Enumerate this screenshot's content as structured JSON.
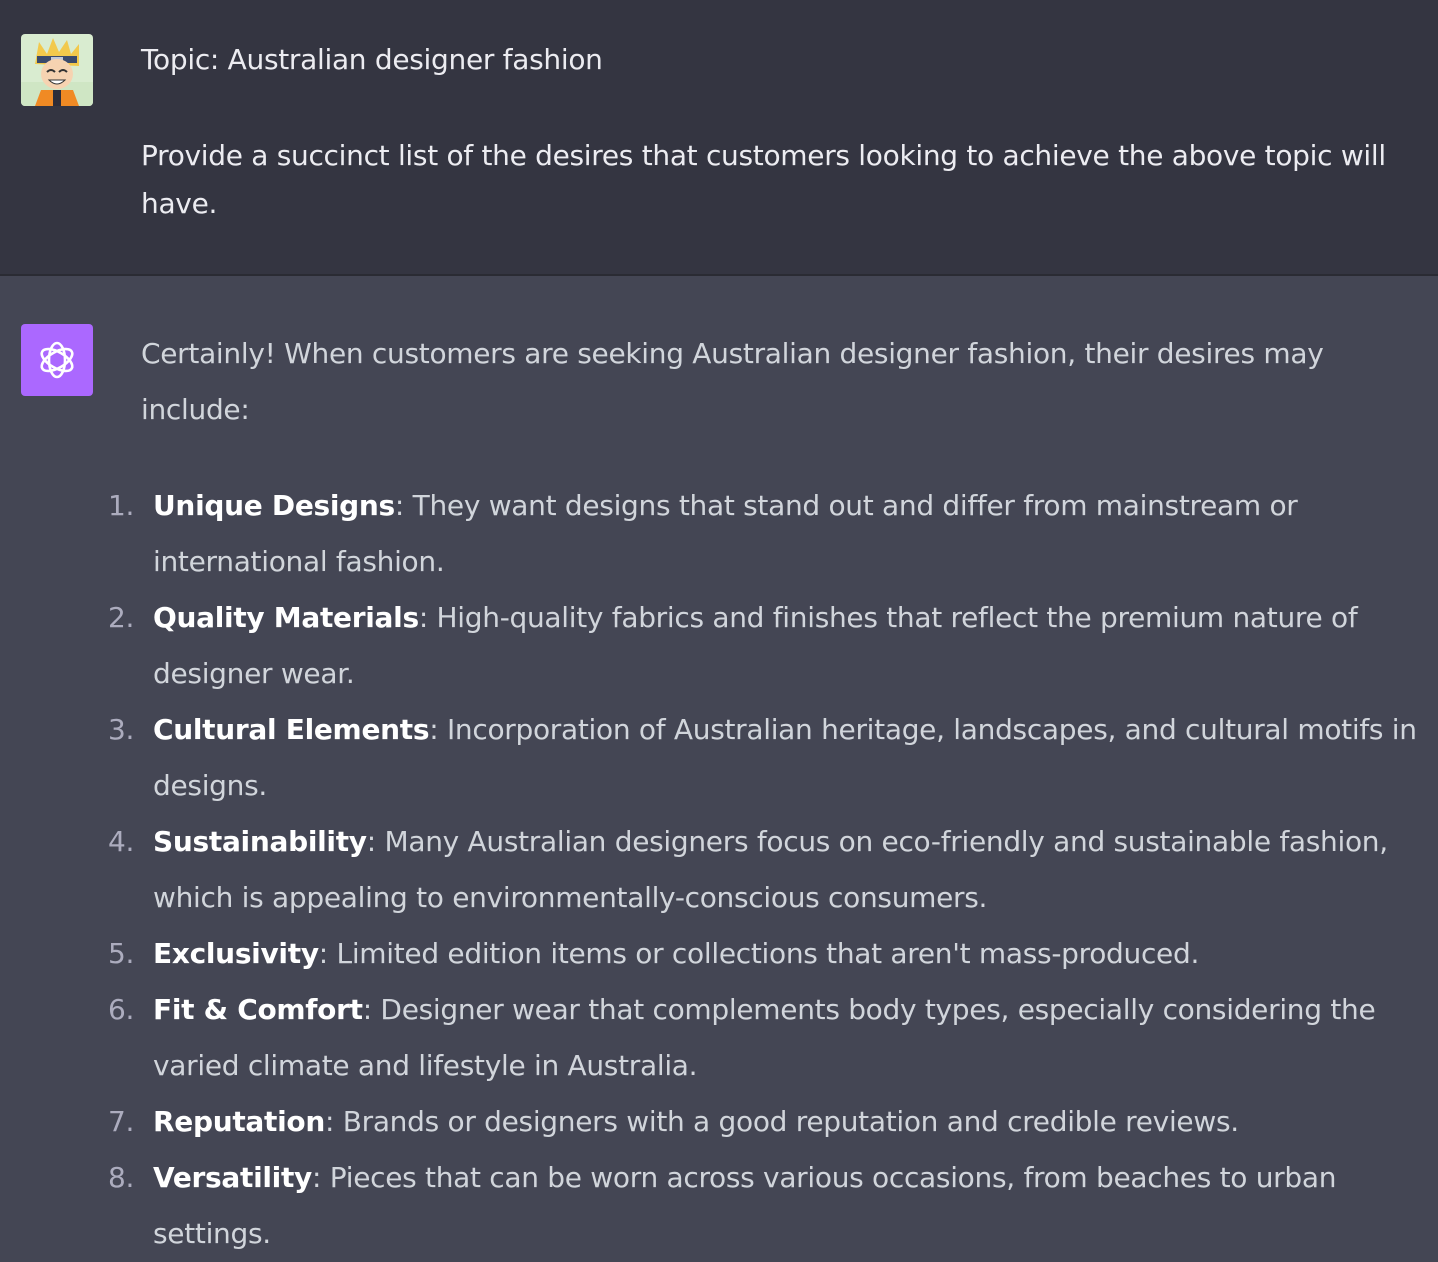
{
  "user_message": {
    "line1": "Topic: Australian designer fashion",
    "line2": "Provide a succinct list of the desires that customers looking to achieve the above topic will have."
  },
  "assistant_message": {
    "intro": "Certainly! When customers are seeking Australian designer fashion, their desires may include:",
    "items": [
      {
        "num": "1.",
        "term": "Unique Designs",
        "desc": ": They want designs that stand out and differ from mainstream or international fashion."
      },
      {
        "num": "2.",
        "term": "Quality Materials",
        "desc": ": High-quality fabrics and finishes that reflect the premium nature of designer wear."
      },
      {
        "num": "3.",
        "term": "Cultural Elements",
        "desc": ": Incorporation of Australian heritage, landscapes, and cultural motifs in designs."
      },
      {
        "num": "4.",
        "term": "Sustainability",
        "desc": ": Many Australian designers focus on eco-friendly and sustainable fashion, which is appealing to environmentally-conscious consumers."
      },
      {
        "num": "5.",
        "term": "Exclusivity",
        "desc": ": Limited edition items or collections that aren't mass-produced."
      },
      {
        "num": "6.",
        "term": "Fit & Comfort",
        "desc": ": Designer wear that complements body types, especially considering the varied climate and lifestyle in Australia."
      },
      {
        "num": "7.",
        "term": "Reputation",
        "desc": ": Brands or designers with a good reputation and credible reviews."
      },
      {
        "num": "8.",
        "term": "Versatility",
        "desc": ": Pieces that can be worn across various occasions, from beaches to urban settings."
      }
    ]
  },
  "icons": {
    "user_avatar": "anime-character-avatar-icon",
    "assistant_avatar": "openai-logo-icon"
  },
  "colors": {
    "user_bg": "#343541",
    "assistant_bg": "#444654",
    "assistant_avatar_bg": "#ab68ff"
  }
}
